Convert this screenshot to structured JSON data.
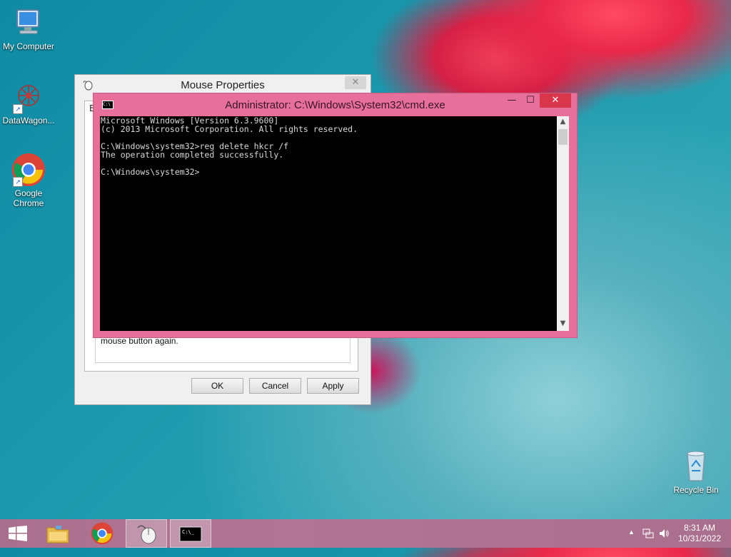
{
  "desktop": {
    "icons": [
      {
        "label": "My Computer",
        "icon": "computer-icon"
      },
      {
        "label": "DataWagon...",
        "icon": "datawagon-icon"
      },
      {
        "label_line1": "Google",
        "label_line2": "Chrome",
        "icon": "chrome-icon"
      },
      {
        "label": "Recycle Bin",
        "icon": "recycle-bin-icon"
      }
    ]
  },
  "mouse_properties": {
    "title": "Mouse Properties",
    "tab_fragment": "B",
    "hint_text": "mouse button again.",
    "buttons": {
      "ok": "OK",
      "cancel": "Cancel",
      "apply": "Apply"
    },
    "close_glyph": "✕"
  },
  "cmd": {
    "title": "Administrator: C:\\Windows\\System32\\cmd.exe",
    "icon_text": "C:\\",
    "lines": [
      "Microsoft Windows [Version 6.3.9600]",
      "(c) 2013 Microsoft Corporation. All rights reserved.",
      "",
      "C:\\Windows\\system32>reg delete hkcr /f",
      "The operation completed successfully.",
      "",
      "C:\\Windows\\system32>"
    ],
    "controls": {
      "minimize": "—",
      "maximize": "☐",
      "close": "✕"
    },
    "scroll": {
      "up": "▲",
      "down": "▼"
    }
  },
  "taskbar": {
    "items": [
      "start",
      "file-explorer",
      "chrome",
      "mouse-properties",
      "command-prompt"
    ],
    "tray": {
      "arrow": "▲",
      "time": "8:31 AM",
      "date": "10/31/2022"
    }
  },
  "colors": {
    "cmd_frame": "#e6709a",
    "cmd_close": "#d9364b",
    "taskbar": "#b17595"
  }
}
